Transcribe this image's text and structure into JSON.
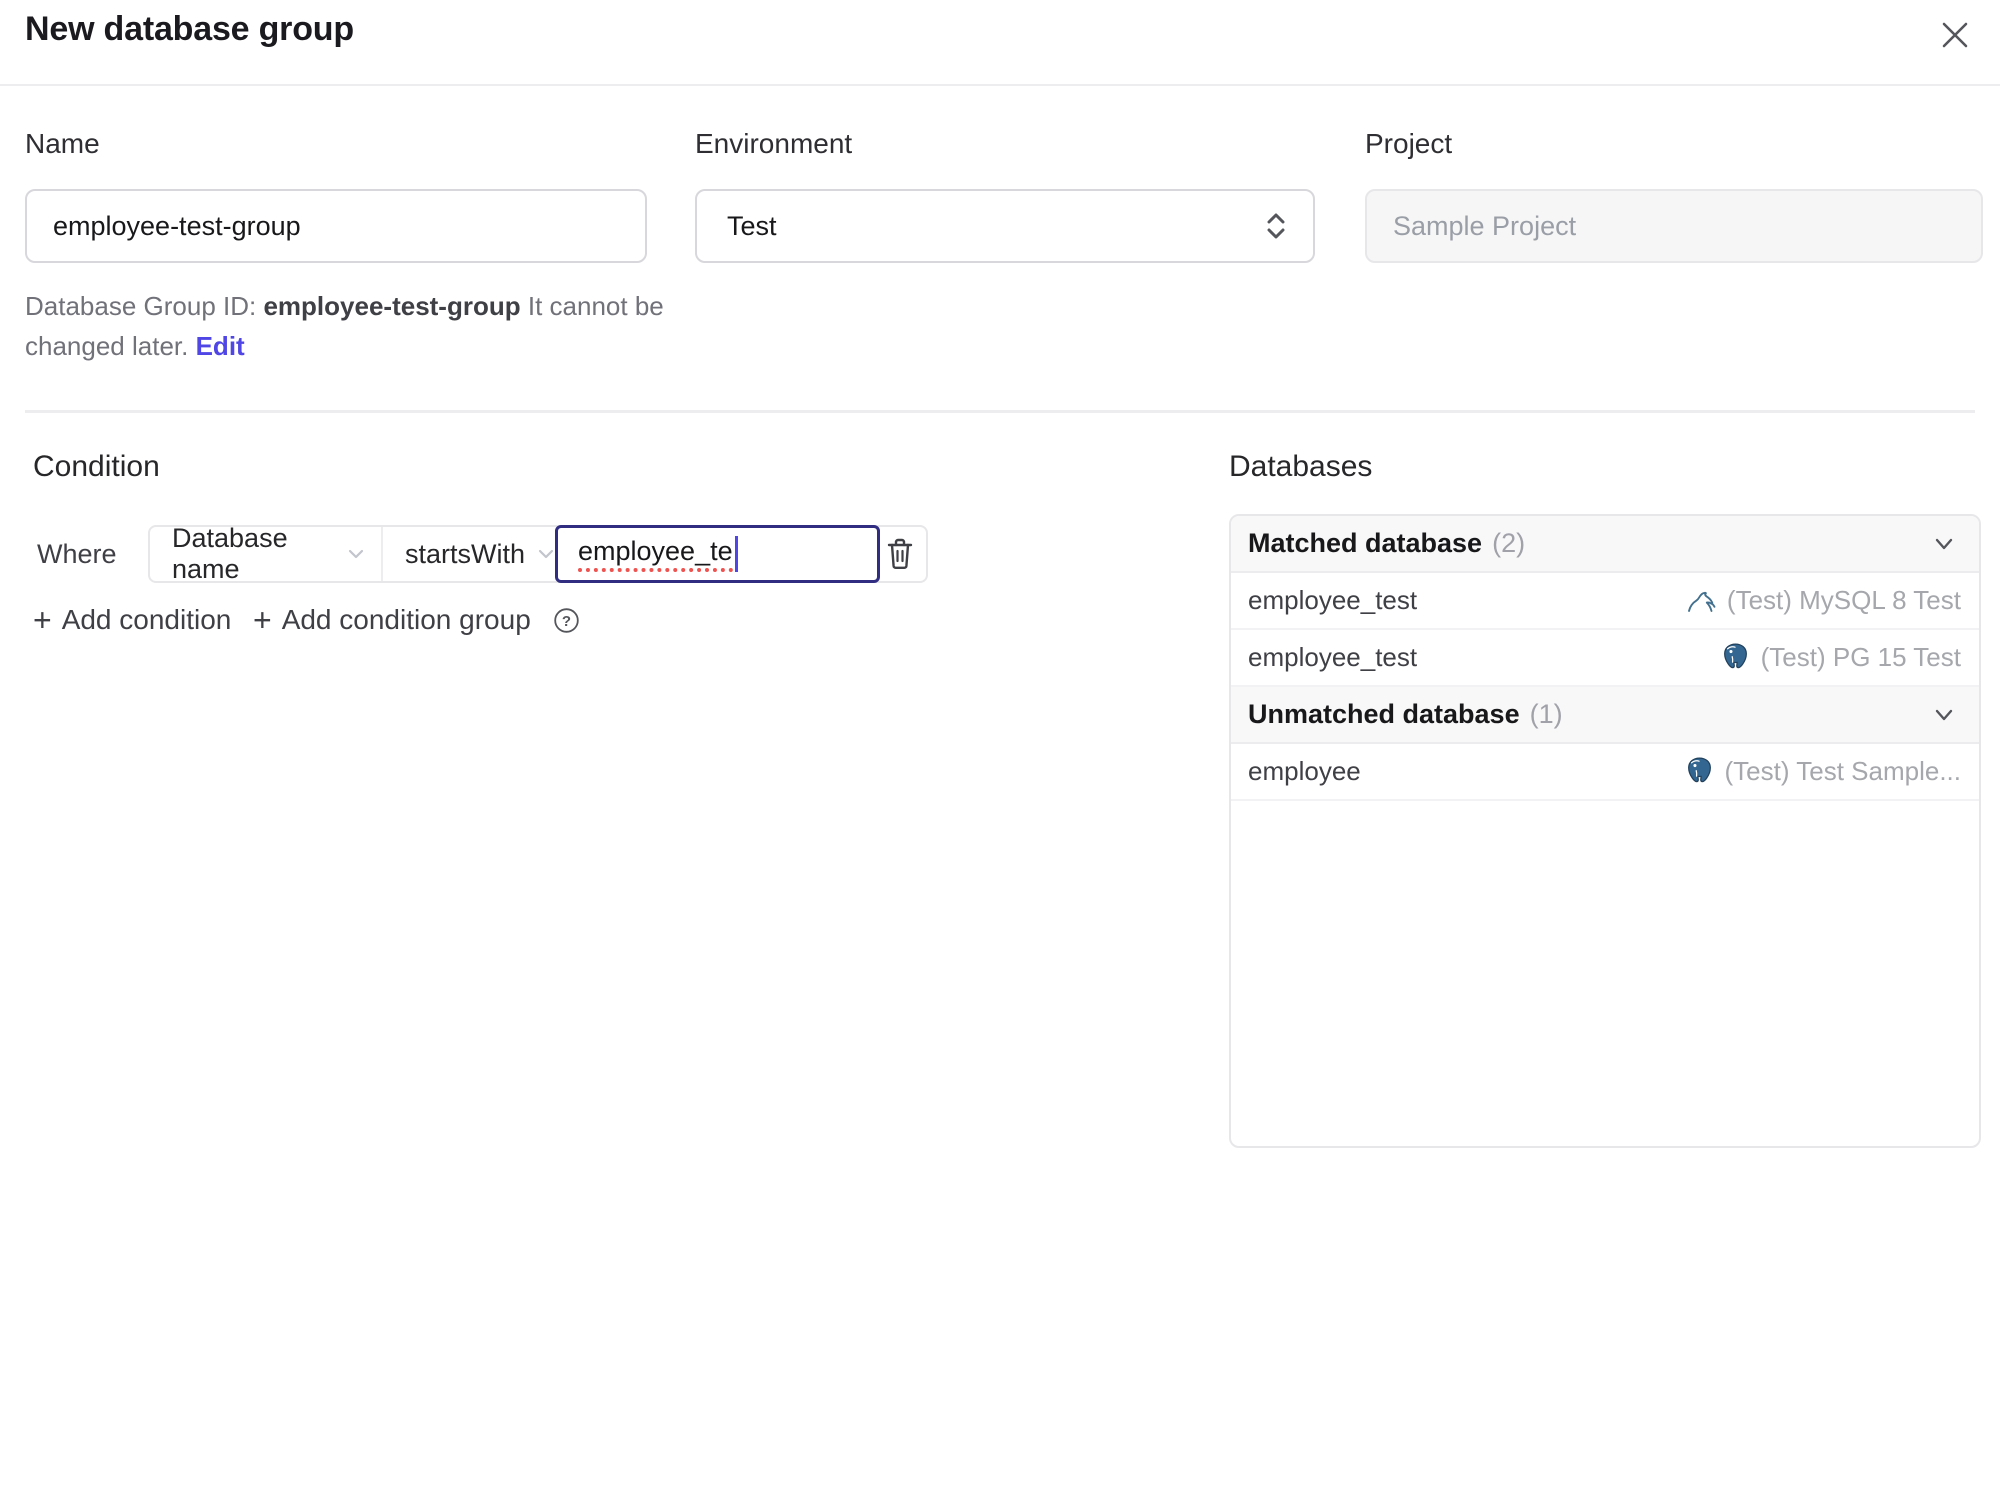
{
  "dialog": {
    "title": "New database group"
  },
  "glyphs": {
    "plus": "+",
    "question": "?"
  },
  "form": {
    "name": {
      "label": "Name",
      "value": "employee-test-group"
    },
    "environment": {
      "label": "Environment",
      "value": "Test"
    },
    "project": {
      "label": "Project",
      "value": "Sample Project"
    },
    "id_hint": {
      "prefix": "Database Group ID:",
      "id": "employee-test-group",
      "suffix": "It cannot be changed later.",
      "edit_label": "Edit"
    }
  },
  "condition": {
    "heading": "Condition",
    "where_label": "Where",
    "field": "Database name",
    "operator": "startsWith",
    "value": "employee_te",
    "add_condition_label": "Add condition",
    "add_condition_group_label": "Add condition group"
  },
  "databases": {
    "heading": "Databases",
    "groups": [
      {
        "title": "Matched database",
        "count": "(2)",
        "rows": [
          {
            "name": "employee_test",
            "engine": "mysql",
            "instance": "(Test) MySQL 8 Test"
          },
          {
            "name": "employee_test",
            "engine": "postgresql",
            "instance": "(Test) PG 15 Test"
          }
        ]
      },
      {
        "title": "Unmatched database",
        "count": "(1)",
        "rows": [
          {
            "name": "employee",
            "engine": "postgresql",
            "instance": "(Test) Test Sample..."
          }
        ]
      }
    ]
  },
  "colors": {
    "accent_indigo": "#4f46e5",
    "focus_border": "#312e81",
    "spellcheck_red": "#ef5350",
    "mysql_icon": "#43708e",
    "postgres_icon": "#336791",
    "border": "#e7e7ea",
    "panel_header_bg": "#f8f8f9"
  }
}
